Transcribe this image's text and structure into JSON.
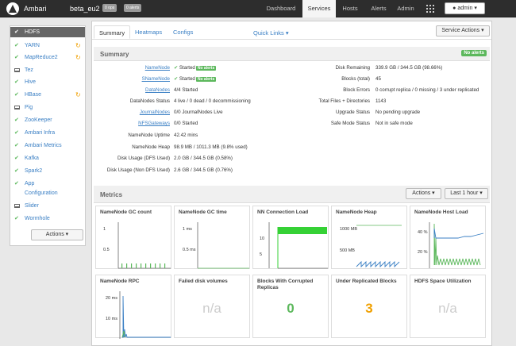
{
  "topbar": {
    "brand": "Ambari",
    "cluster": "beta_eu2",
    "ops_badge": "0 ops",
    "alerts_badge": "0 alerts",
    "nav": [
      "Dashboard",
      "Services",
      "Hosts",
      "Alerts",
      "Admin"
    ],
    "active_nav": "Services",
    "user": "admin ▾"
  },
  "sidebar": {
    "items": [
      {
        "label": "HDFS",
        "status": "ok",
        "active": true
      },
      {
        "label": "YARN",
        "status": "ok",
        "refresh": true
      },
      {
        "label": "MapReduce2",
        "status": "ok",
        "refresh": true
      },
      {
        "label": "Tez",
        "status": "client"
      },
      {
        "label": "Hive",
        "status": "ok"
      },
      {
        "label": "HBase",
        "status": "ok",
        "refresh": true
      },
      {
        "label": "Pig",
        "status": "client"
      },
      {
        "label": "ZooKeeper",
        "status": "ok"
      },
      {
        "label": "Ambari Infra",
        "status": "ok"
      },
      {
        "label": "Ambari Metrics",
        "status": "ok"
      },
      {
        "label": "Kafka",
        "status": "ok"
      },
      {
        "label": "Spark2",
        "status": "ok"
      },
      {
        "label": "App",
        "label2": "Configuration",
        "status": "ok"
      },
      {
        "label": "Slider",
        "status": "client"
      },
      {
        "label": "Wormhole",
        "status": "ok"
      }
    ],
    "actions": "Actions ▾"
  },
  "tabs": [
    "Summary",
    "Heatmaps",
    "Configs"
  ],
  "quick_links": "Quick Links ▾",
  "service_actions": "Service Actions ▾",
  "summary": {
    "title": "Summary",
    "no_alerts": "No alerts",
    "left": [
      {
        "k": "NameNode",
        "v": "Started",
        "link": true,
        "badge": "No alerts"
      },
      {
        "k": "SNameNode",
        "v": "Started",
        "link": true,
        "badge": "No alerts"
      },
      {
        "k": "DataNodes",
        "v": "4/4 Started",
        "link": true
      },
      {
        "k": "DataNodes Status",
        "v": "4 live / 0 dead / 0 decommissioning"
      },
      {
        "k": "JournalNodes",
        "v": "0/0 JournalNodes Live",
        "link": true
      },
      {
        "k": "NFSGateways",
        "v": "0/0 Started",
        "link": true
      },
      {
        "k": "NameNode Uptime",
        "v": "42.42 mins"
      },
      {
        "k": "NameNode Heap",
        "v": "98.9 MB / 1011.3 MB (9.8% used)"
      },
      {
        "k": "Disk Usage (DFS Used)",
        "v": "2.0 GB / 344.5 GB (0.58%)"
      },
      {
        "k": "Disk Usage (Non DFS Used)",
        "v": "2.6 GB / 344.5 GB (0.76%)"
      }
    ],
    "right": [
      {
        "k": "Disk Remaining",
        "v": "339.9 GB / 344.5 GB (98.66%)"
      },
      {
        "k": "Blocks (total)",
        "v": "45"
      },
      {
        "k": "Block Errors",
        "v": "0 corrupt replica / 0 missing / 3 under replicated"
      },
      {
        "k": "Total Files + Directories",
        "v": "1143"
      },
      {
        "k": "Upgrade Status",
        "v": "No pending upgrade"
      },
      {
        "k": "Safe Mode Status",
        "v": "Not in safe mode"
      }
    ]
  },
  "metrics": {
    "title": "Metrics",
    "actions": "Actions ▾",
    "range": "Last 1 hour ▾",
    "cards": [
      {
        "title": "NameNode GC count",
        "y_ticks": [
          "1",
          "0.5"
        ]
      },
      {
        "title": "NameNode GC time",
        "y_ticks": [
          "1 ms",
          "0.5 ms"
        ]
      },
      {
        "title": "NN Connection Load",
        "y_ticks": [
          "10",
          "5"
        ]
      },
      {
        "title": "NameNode Heap",
        "y_ticks": [
          "1000 MB",
          "500 MB"
        ]
      },
      {
        "title": "NameNode Host Load",
        "y_ticks": [
          "40 %",
          "20 %"
        ]
      },
      {
        "title": "NameNode RPC",
        "y_ticks": [
          "20 ms",
          "10 ms"
        ]
      },
      {
        "title": "Failed disk volumes",
        "value": "n/a"
      },
      {
        "title": "Blocks With Corrupted Replicas",
        "value": "0",
        "color": "#5cb85c"
      },
      {
        "title": "Under Replicated Blocks",
        "value": "3",
        "color": "#f0a000"
      },
      {
        "title": "HDFS Space Utilization",
        "value": "n/a"
      }
    ]
  }
}
